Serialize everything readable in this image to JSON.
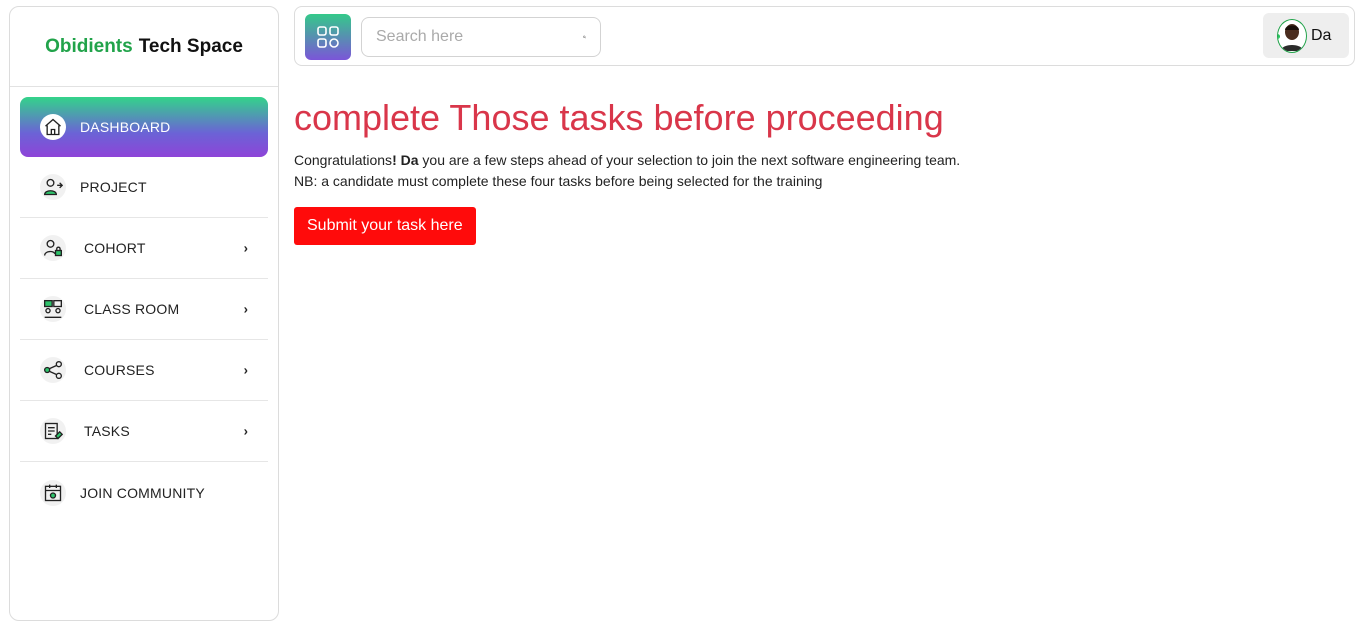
{
  "brand": {
    "part1": "Obidients",
    "part2": "Tech Space"
  },
  "sidebar": {
    "items": [
      {
        "label": "DASHBOARD",
        "icon": "home-icon",
        "active": true,
        "chevron": false
      },
      {
        "label": "PROJECT",
        "icon": "user-arrow-icon",
        "chevron": false
      },
      {
        "label": "COHORT",
        "icon": "user-lock-icon",
        "chevron": true
      },
      {
        "label": "CLASS ROOM",
        "icon": "classroom-icon",
        "chevron": true
      },
      {
        "label": "COURSES",
        "icon": "share-nodes-icon",
        "chevron": true
      },
      {
        "label": "TASKS",
        "icon": "task-list-icon",
        "chevron": true
      },
      {
        "label": "JOIN COMMUNITY",
        "icon": "calendar-community-icon",
        "chevron": false
      }
    ],
    "chevron_glyph": "›"
  },
  "topbar": {
    "search_placeholder": "Search here",
    "user_name": "Da"
  },
  "main": {
    "heading": "complete Those tasks before proceeding",
    "congrats_prefix": "Congratulations",
    "congrats_bang": "!",
    "congrats_name": "Da",
    "congrats_suffix": " you are a few steps ahead of your selection to join the next software engineering team.",
    "note": "NB: a candidate must complete these four tasks before being selected for the training",
    "submit_label": "Submit your task here"
  },
  "colors": {
    "brand_green": "#21a34a",
    "heading_red": "#d9364a",
    "submit_red": "#ff0b0b",
    "active_gradient_top": "#33d38a",
    "active_gradient_bottom": "#8e44d8"
  }
}
